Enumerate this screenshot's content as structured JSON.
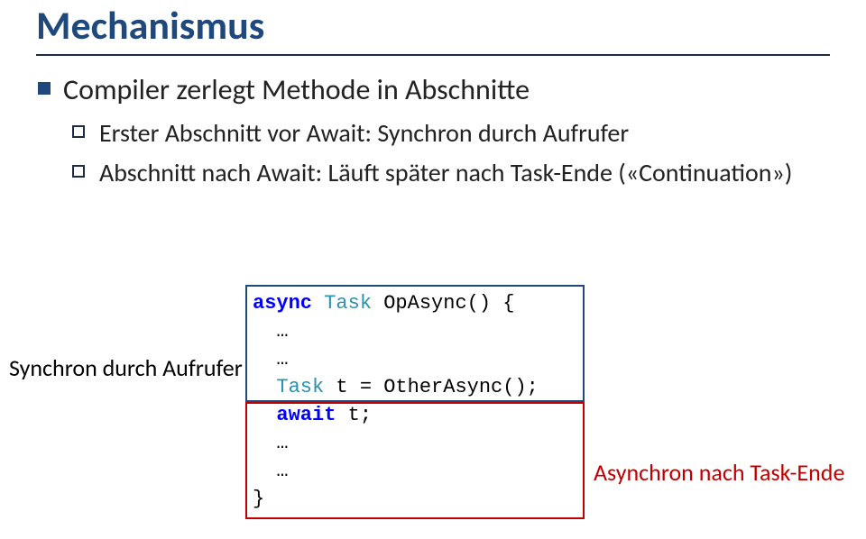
{
  "title": "Mechanismus",
  "bullet1": "Compiler zerlegt Methode in Abschnitte",
  "bullet2a": "Erster Abschnitt vor Await: Synchron durch Aufrufer",
  "bullet2b": "Abschnitt nach Await: Läuft später nach Task-Ende («Continuation»)",
  "labels": {
    "caller": "Synchron durch Aufrufer",
    "asyncEnd": "Asynchron nach Task-Ende"
  },
  "code": {
    "kw_async": "async",
    "type_task1": "Task",
    "fn_sig_tail": " OpAsync() {",
    "ellipsis": "…",
    "type_task2": "Task",
    "decl_tail": " t = OtherAsync();",
    "kw_await": "await",
    "await_tail": " t;",
    "close": "}"
  }
}
